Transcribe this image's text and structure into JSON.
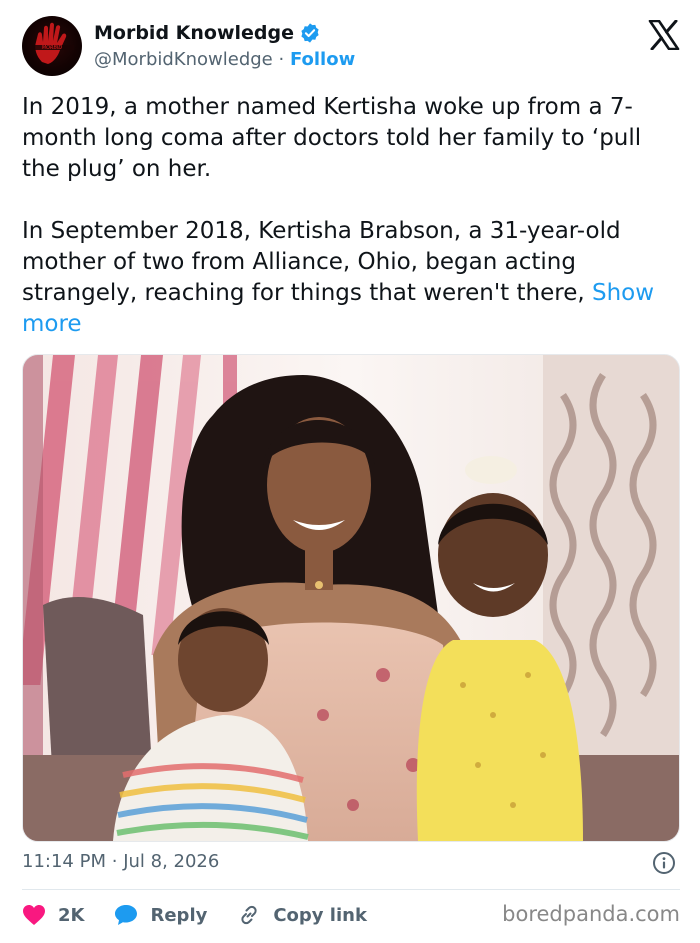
{
  "author": {
    "display_name": "Morbid Knowledge",
    "handle": "@MorbidKnowledge",
    "separator": "·",
    "follow_label": "Follow",
    "verified": true,
    "avatar_icon": "red-hand-logo-icon"
  },
  "platform_icon": "x-logo-icon",
  "tweet": {
    "paragraph1": "In 2019, a mother named Kertisha woke up from a 7-month long coma after doctors told her family to ‘pull the plug’ on her.",
    "paragraph2": "In September 2018, Kertisha Brabson, a 31-year-old mother of two from Alliance, Ohio, began acting strangely, reaching for things that weren't there,",
    "show_more": "Show more"
  },
  "meta": {
    "time": "11:14 PM",
    "separator": "·",
    "date": "Jul 8, 2026"
  },
  "actions": {
    "likes": "2K",
    "reply_label": "Reply",
    "copy_link_label": "Copy link"
  },
  "watermark": "boredpanda.com",
  "colors": {
    "accent": "#1d9bf0",
    "like": "#f91880",
    "text": "#0f1419",
    "secondary": "#536471"
  }
}
